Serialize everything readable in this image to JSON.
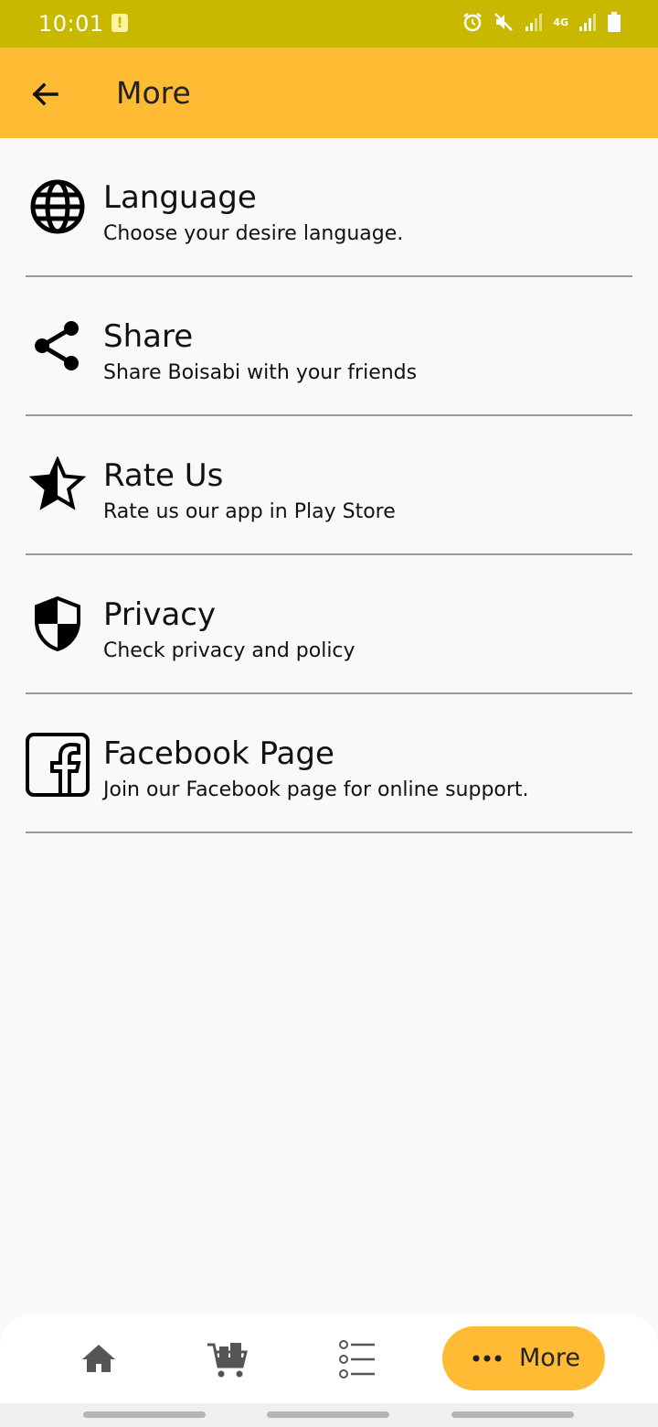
{
  "status_bar": {
    "time": "10:01",
    "alert_glyph": "!",
    "icons": [
      "alarm-icon",
      "mute-icon",
      "signal-icon",
      "4g-icon",
      "signal-icon",
      "battery-icon"
    ],
    "network_label": "4G"
  },
  "app_bar": {
    "title": "More",
    "back_icon": "arrow-back-icon",
    "color": "#ffbb33"
  },
  "menu": {
    "items": [
      {
        "icon": "globe-icon",
        "title": "Language",
        "subtitle": "Choose your desire language."
      },
      {
        "icon": "share-icon",
        "title": "Share",
        "subtitle": "Share Boisabi with your friends"
      },
      {
        "icon": "star-half-icon",
        "title": "Rate Us",
        "subtitle": "Rate us our app in Play Store"
      },
      {
        "icon": "shield-icon",
        "title": "Privacy",
        "subtitle": "Check privacy and policy"
      },
      {
        "icon": "facebook-icon",
        "title": "Facebook Page",
        "subtitle": "Join our Facebook page for online support."
      }
    ]
  },
  "bottom_nav": {
    "items": [
      "home-icon",
      "cart-icon",
      "list-icon"
    ],
    "active_label": "More",
    "active_icon": "more-dots-icon",
    "active_color": "#ffbb33"
  },
  "colors": {
    "status_bar": "#c9b800",
    "accent": "#ffbb33",
    "background": "#f9f9f9"
  }
}
